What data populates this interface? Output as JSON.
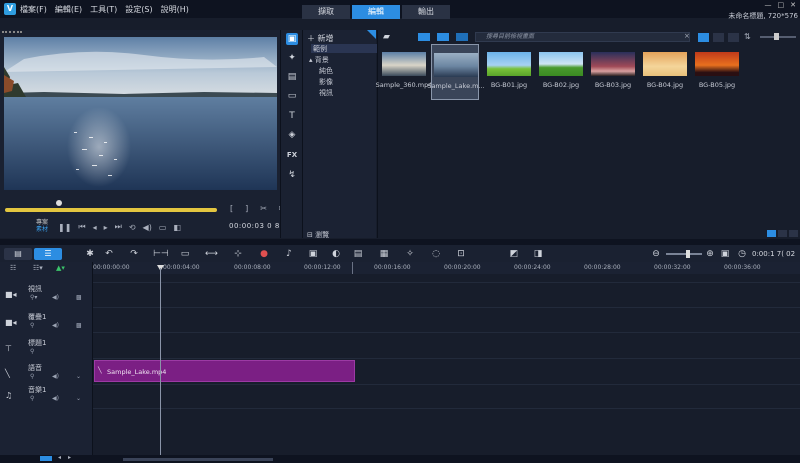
{
  "app": {
    "menu": [
      "檔案(F)",
      "編輯(E)",
      "工具(T)",
      "設定(S)",
      "說明(H)"
    ],
    "mode_tabs": [
      "擷取",
      "編輯",
      "輸出"
    ],
    "active_mode": "編輯",
    "project_title": "未命名標題, 720*576",
    "window_controls": [
      "—",
      "□",
      "✕"
    ]
  },
  "preview": {
    "mode_label_project": "專案",
    "mode_label_clip": "素材",
    "timecode": "00:00:03 0 8",
    "controls": [
      "play",
      "home",
      "prev",
      "next",
      "end",
      "repeat",
      "volume"
    ]
  },
  "library_nav": {
    "add_label": "新增",
    "items": [
      {
        "label": "範例",
        "indent": 1,
        "selected": true
      },
      {
        "label": "▴ 背景",
        "indent": 0,
        "selected": false
      },
      {
        "label": "純色",
        "indent": 2,
        "selected": false
      },
      {
        "label": "影像",
        "indent": 2,
        "selected": false
      },
      {
        "label": "視訊",
        "indent": 2,
        "selected": false
      }
    ],
    "browse_label": "瀏覽",
    "strip_icons": [
      "media-icon",
      "instant-project-icon",
      "transition-icon",
      "title-icon-frame",
      "text-icon",
      "graphics-icon",
      "fx-icon",
      "path-icon"
    ],
    "strip_labels": [
      "▣",
      "✦",
      "▤",
      "▭",
      "T",
      "◈",
      "FX",
      "↯"
    ]
  },
  "library": {
    "search_placeholder": "搜尋目前檢視畫面",
    "search_clear": "×",
    "thumbnails": [
      {
        "name": "Sample_360.mp4",
        "colors": [
          "#5b7fa6",
          "#d9d5c8",
          "#3a4a5a"
        ],
        "selected": false
      },
      {
        "name": "Sample_Lake.m...",
        "colors": [
          "#9bb0c4",
          "#6c86a2",
          "#2a3a52"
        ],
        "selected": true
      },
      {
        "name": "BG-B01.jpg",
        "colors": [
          "#6cb3ea",
          "#a7d2f2",
          "#79c23a"
        ],
        "selected": false
      },
      {
        "name": "BG-B02.jpg",
        "colors": [
          "#8bc4ee",
          "#cfe5f4",
          "#4a9a2e"
        ],
        "selected": false
      },
      {
        "name": "BG-B03.jpg",
        "colors": [
          "#2a2f5a",
          "#a04a58",
          "#d9a0a0"
        ],
        "selected": false
      },
      {
        "name": "BG-B04.jpg",
        "colors": [
          "#e4a35a",
          "#f4d59a",
          "#e8c07a"
        ],
        "selected": false
      },
      {
        "name": "BG-B05.jpg",
        "colors": [
          "#c03a1a",
          "#e8701e",
          "#2a0f12"
        ],
        "selected": false
      }
    ]
  },
  "timeline": {
    "timecode": "0:00:1 7( 02",
    "ruler": [
      "00:00:00:00",
      "00:00:04:00",
      "00:00:08:00",
      "00:00:12:00",
      "00:00:16:00",
      "00:00:20:00",
      "00:00:24:00",
      "00:00:28:00",
      "00:00:32:00",
      "00:00:36:00"
    ],
    "tracks": [
      {
        "name": "視訊",
        "icon": "video-track-icon",
        "glyph": "■"
      },
      {
        "name": "覆疊1",
        "icon": "overlay-track-icon",
        "glyph": "■"
      },
      {
        "name": "標題1",
        "icon": "title-track-icon",
        "glyph": "T"
      },
      {
        "name": "語音",
        "icon": "voice-track-icon",
        "glyph": "●"
      },
      {
        "name": "音樂1",
        "icon": "music-track-icon",
        "glyph": "♫"
      }
    ],
    "clip": {
      "label": "Sample_Lake.mp4",
      "color": "#7b1f84"
    }
  },
  "colors": {
    "accent": "#2c8de2",
    "scrub": "#e3c640"
  }
}
